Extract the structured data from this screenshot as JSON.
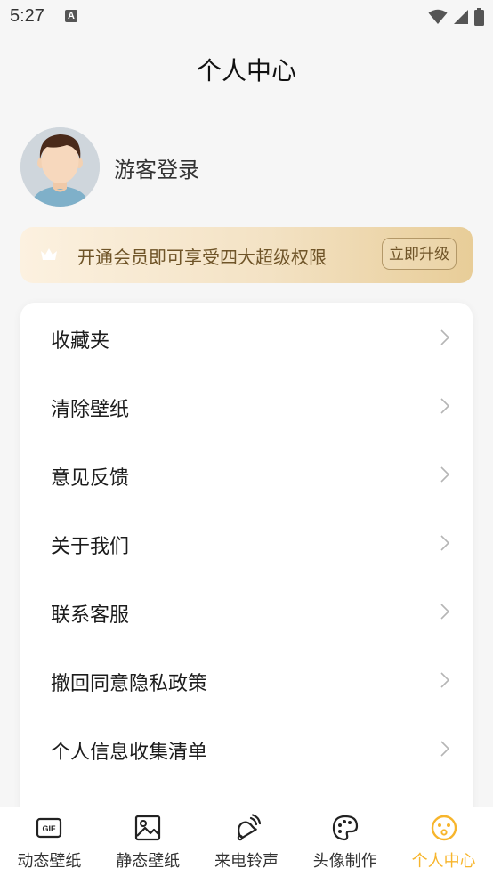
{
  "status_bar": {
    "time": "5:27",
    "notification_letter": "A"
  },
  "header": {
    "title": "个人中心"
  },
  "profile": {
    "login_text": "游客登录"
  },
  "vip_banner": {
    "text": "开通会员即可享受四大超级权限",
    "button_label": "立即升级"
  },
  "menu": {
    "items": [
      {
        "label": "收藏夹"
      },
      {
        "label": "清除壁纸"
      },
      {
        "label": "意见反馈"
      },
      {
        "label": "关于我们"
      },
      {
        "label": "联系客服"
      },
      {
        "label": "撤回同意隐私政策"
      },
      {
        "label": "个人信息收集清单"
      }
    ]
  },
  "tab_bar": {
    "tabs": [
      {
        "label": "动态壁纸",
        "icon": "gif-icon"
      },
      {
        "label": "静态壁纸",
        "icon": "image-icon"
      },
      {
        "label": "来电铃声",
        "icon": "bell-icon"
      },
      {
        "label": "头像制作",
        "icon": "palette-icon"
      },
      {
        "label": "个人中心",
        "icon": "smiley-icon"
      }
    ],
    "active_index": 4
  },
  "colors": {
    "accent": "#f7b52c",
    "vip_text": "#6f5428",
    "background": "#f6f6f6"
  }
}
